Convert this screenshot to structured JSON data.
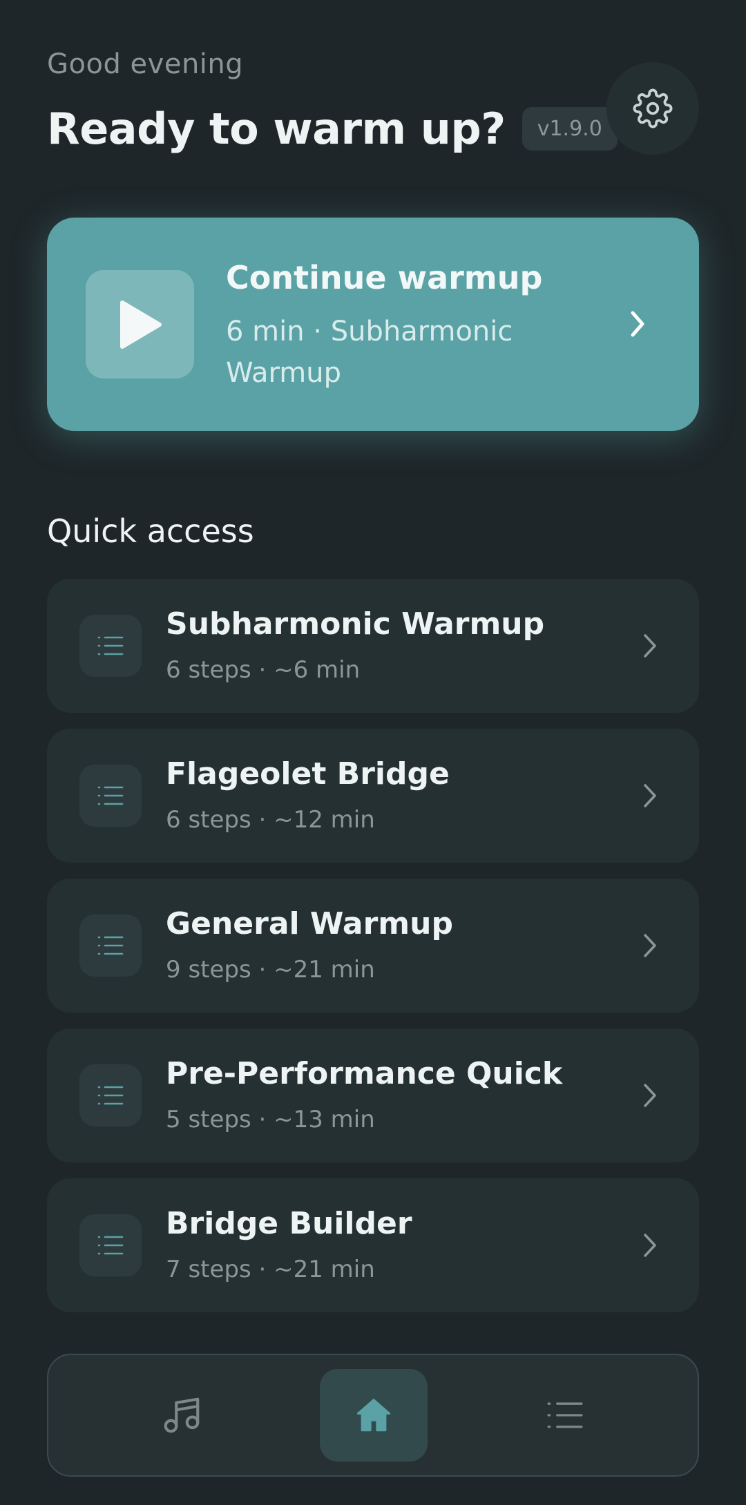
{
  "header": {
    "greeting": "Good evening",
    "title": "Ready to warm up?",
    "version": "v1.9.0",
    "settings_icon": "gear-icon"
  },
  "continue_card": {
    "title": "Continue warmup",
    "subtitle": "6 min · Subharmonic Warmup",
    "icon": "play-icon",
    "accent": "#5aa2a5"
  },
  "quick_access": {
    "title": "Quick access",
    "items": [
      {
        "title": "Subharmonic Warmup",
        "meta": "6 steps · ~6 min"
      },
      {
        "title": "Flageolet Bridge",
        "meta": "6 steps · ~12 min"
      },
      {
        "title": "General Warmup",
        "meta": "9 steps · ~21 min"
      },
      {
        "title": "Pre-Performance Quick",
        "meta": "5 steps · ~13 min"
      },
      {
        "title": "Bridge Builder",
        "meta": "7 steps · ~21 min"
      }
    ]
  },
  "bottom_nav": {
    "items": [
      {
        "icon": "music-note-icon",
        "active": false
      },
      {
        "icon": "home-icon",
        "active": true
      },
      {
        "icon": "list-icon",
        "active": false
      }
    ]
  }
}
